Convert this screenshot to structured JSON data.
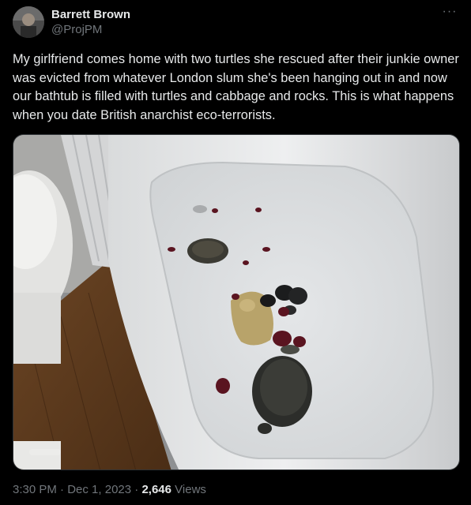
{
  "author": {
    "display_name": "Barrett Brown",
    "handle": "@ProjPM"
  },
  "more_icon": "more-horizontal-icon",
  "tweet": {
    "text": "My girlfriend comes home with two turtles she rescued after their junkie owner was evicted from whatever London slum she's been hanging out in and now our bathtub is filled with turtles and cabbage and rocks. This is what happens when you date British anarchist eco-terrorists."
  },
  "meta": {
    "time": "3:30 PM",
    "separator": " · ",
    "date": "Dec 1, 2023",
    "separator2": " · ",
    "views_count": "2,646",
    "views_label": " Views"
  }
}
